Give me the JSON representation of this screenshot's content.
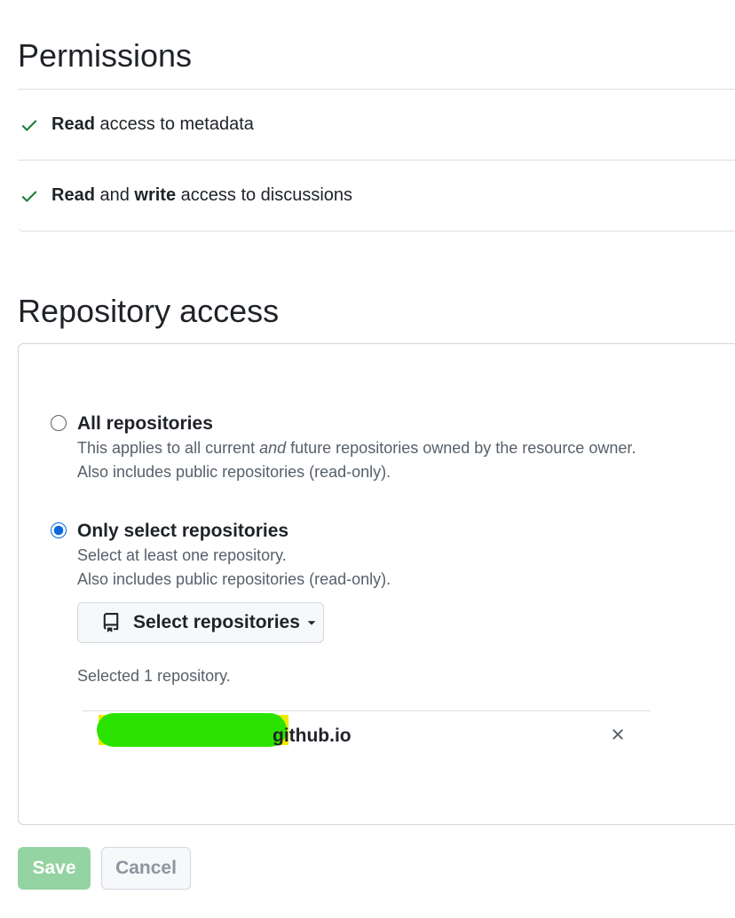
{
  "permissions": {
    "title": "Permissions",
    "items": [
      {
        "parts": [
          {
            "text": "Read",
            "bold": true
          },
          {
            "text": " access to metadata",
            "bold": false
          }
        ]
      },
      {
        "parts": [
          {
            "text": "Read",
            "bold": true
          },
          {
            "text": " and ",
            "bold": false
          },
          {
            "text": "write",
            "bold": true
          },
          {
            "text": " access to discussions",
            "bold": false
          }
        ]
      }
    ],
    "check_icon": "check-icon",
    "check_color": "#1a7f37"
  },
  "repository_access": {
    "title": "Repository access",
    "options": {
      "all": {
        "label": "All repositories",
        "checked": false,
        "desc_line1_a": "This applies to all current ",
        "desc_line1_b": "and",
        "desc_line1_c": " future repositories owned by the resource owner.",
        "desc_line2": "Also includes public repositories (read-only)."
      },
      "select": {
        "label": "Only select repositories",
        "checked": true,
        "desc_line1": "Select at least one repository.",
        "desc_line2": "Also includes public repositories (read-only)."
      }
    },
    "select_button": {
      "label": "Select repositories",
      "icon": "repo-icon",
      "caret_icon": "caret-down-icon"
    },
    "selected_count": "Selected 1 repository.",
    "selected_repos": [
      {
        "name": "github.io",
        "redacted_prefix": true,
        "remove_icon": "close-icon"
      }
    ]
  },
  "actions": {
    "save_label": "Save",
    "cancel_label": "Cancel"
  },
  "colors": {
    "accent": "#0969da",
    "save_bg_disabled": "#94d3a2",
    "redaction_green": "#2be300",
    "redaction_yellow": "#f0e800"
  }
}
